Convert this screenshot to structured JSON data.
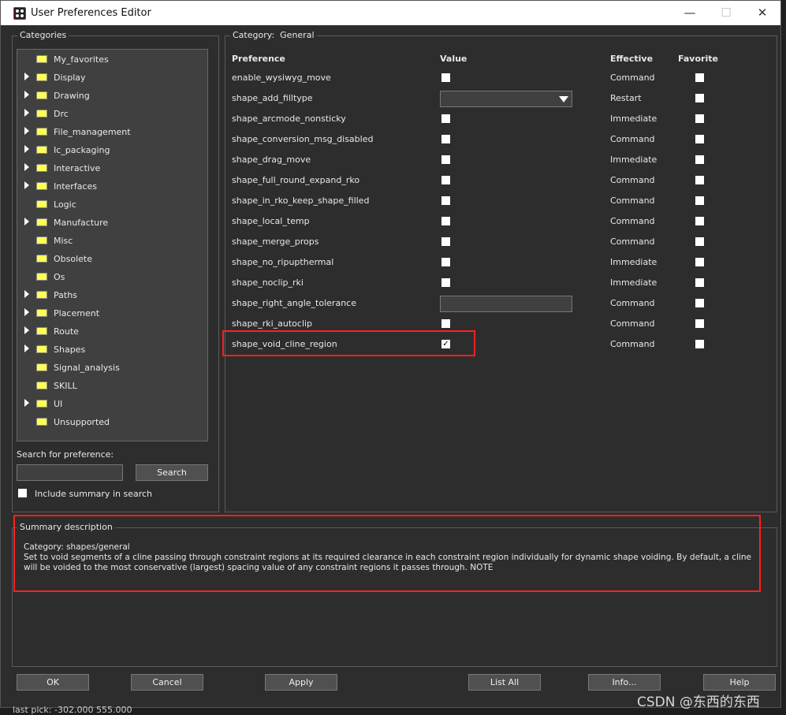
{
  "window": {
    "title": "User Preferences Editor",
    "minimize": "—",
    "maximize": "☐",
    "close": "✕"
  },
  "categories": {
    "legend": "Categories",
    "items": [
      {
        "label": "My_favorites",
        "expandable": false
      },
      {
        "label": "Display",
        "expandable": true
      },
      {
        "label": "Drawing",
        "expandable": true
      },
      {
        "label": "Drc",
        "expandable": true
      },
      {
        "label": "File_management",
        "expandable": true
      },
      {
        "label": "Ic_packaging",
        "expandable": true
      },
      {
        "label": "Interactive",
        "expandable": true
      },
      {
        "label": "Interfaces",
        "expandable": true
      },
      {
        "label": "Logic",
        "expandable": false
      },
      {
        "label": "Manufacture",
        "expandable": true
      },
      {
        "label": "Misc",
        "expandable": false
      },
      {
        "label": "Obsolete",
        "expandable": false
      },
      {
        "label": "Os",
        "expandable": false
      },
      {
        "label": "Paths",
        "expandable": true
      },
      {
        "label": "Placement",
        "expandable": true
      },
      {
        "label": "Route",
        "expandable": true
      },
      {
        "label": "Shapes",
        "expandable": true
      },
      {
        "label": "Signal_analysis",
        "expandable": false
      },
      {
        "label": "SKILL",
        "expandable": false
      },
      {
        "label": "UI",
        "expandable": true
      },
      {
        "label": "Unsupported",
        "expandable": false
      }
    ]
  },
  "search": {
    "label": "Search for preference:",
    "value": "",
    "button": "Search",
    "include_summary": "Include summary in search",
    "include_summary_checked": false
  },
  "category": {
    "legend_prefix": "Category:",
    "legend_value": "General",
    "headers": {
      "preference": "Preference",
      "value": "Value",
      "effective": "Effective",
      "favorite": "Favorite"
    },
    "rows": [
      {
        "name": "enable_wysiwyg_move",
        "type": "checkbox",
        "checked": false,
        "effective": "Command",
        "favorite": false
      },
      {
        "name": "shape_add_filltype",
        "type": "dropdown",
        "value": "",
        "effective": "Restart",
        "favorite": false
      },
      {
        "name": "shape_arcmode_nonsticky",
        "type": "checkbox",
        "checked": false,
        "effective": "Immediate",
        "favorite": false
      },
      {
        "name": "shape_conversion_msg_disabled",
        "type": "checkbox",
        "checked": false,
        "effective": "Command",
        "favorite": false
      },
      {
        "name": "shape_drag_move",
        "type": "checkbox",
        "checked": false,
        "effective": "Immediate",
        "favorite": false
      },
      {
        "name": "shape_full_round_expand_rko",
        "type": "checkbox",
        "checked": false,
        "effective": "Command",
        "favorite": false
      },
      {
        "name": "shape_in_rko_keep_shape_filled",
        "type": "checkbox",
        "checked": false,
        "effective": "Command",
        "favorite": false
      },
      {
        "name": "shape_local_temp",
        "type": "checkbox",
        "checked": false,
        "effective": "Command",
        "favorite": false
      },
      {
        "name": "shape_merge_props",
        "type": "checkbox",
        "checked": false,
        "effective": "Command",
        "favorite": false
      },
      {
        "name": "shape_no_ripupthermal",
        "type": "checkbox",
        "checked": false,
        "effective": "Immediate",
        "favorite": false
      },
      {
        "name": "shape_noclip_rki",
        "type": "checkbox",
        "checked": false,
        "effective": "Immediate",
        "favorite": false
      },
      {
        "name": "shape_right_angle_tolerance",
        "type": "text",
        "value": "",
        "effective": "Command",
        "favorite": false
      },
      {
        "name": "shape_rki_autoclip",
        "type": "checkbox",
        "checked": false,
        "effective": "Command",
        "favorite": false
      },
      {
        "name": "shape_void_cline_region",
        "type": "checkbox",
        "checked": true,
        "effective": "Command",
        "favorite": false
      }
    ]
  },
  "summary": {
    "legend": "Summary description",
    "category_line": "Category: shapes/general",
    "text": "Set to void segments of a cline  passing through constraint regions at its required clearance in each constraint region individually for dynamic shape voiding. By default, a cline will be voided to the most conservative (largest) spacing value of any constraint regions it passes through. NOTE"
  },
  "buttons": {
    "ok": "OK",
    "cancel": "Cancel",
    "apply": "Apply",
    "list_all": "List All",
    "info": "Info...",
    "help": "Help"
  },
  "status": {
    "last_pick": "last pick:  -302.000 555.000"
  },
  "watermark": "CSDN @东西的东西",
  "colors": {
    "background": "#2d2d2d",
    "highlight": "#ff2020",
    "folder": "#ffff55"
  }
}
